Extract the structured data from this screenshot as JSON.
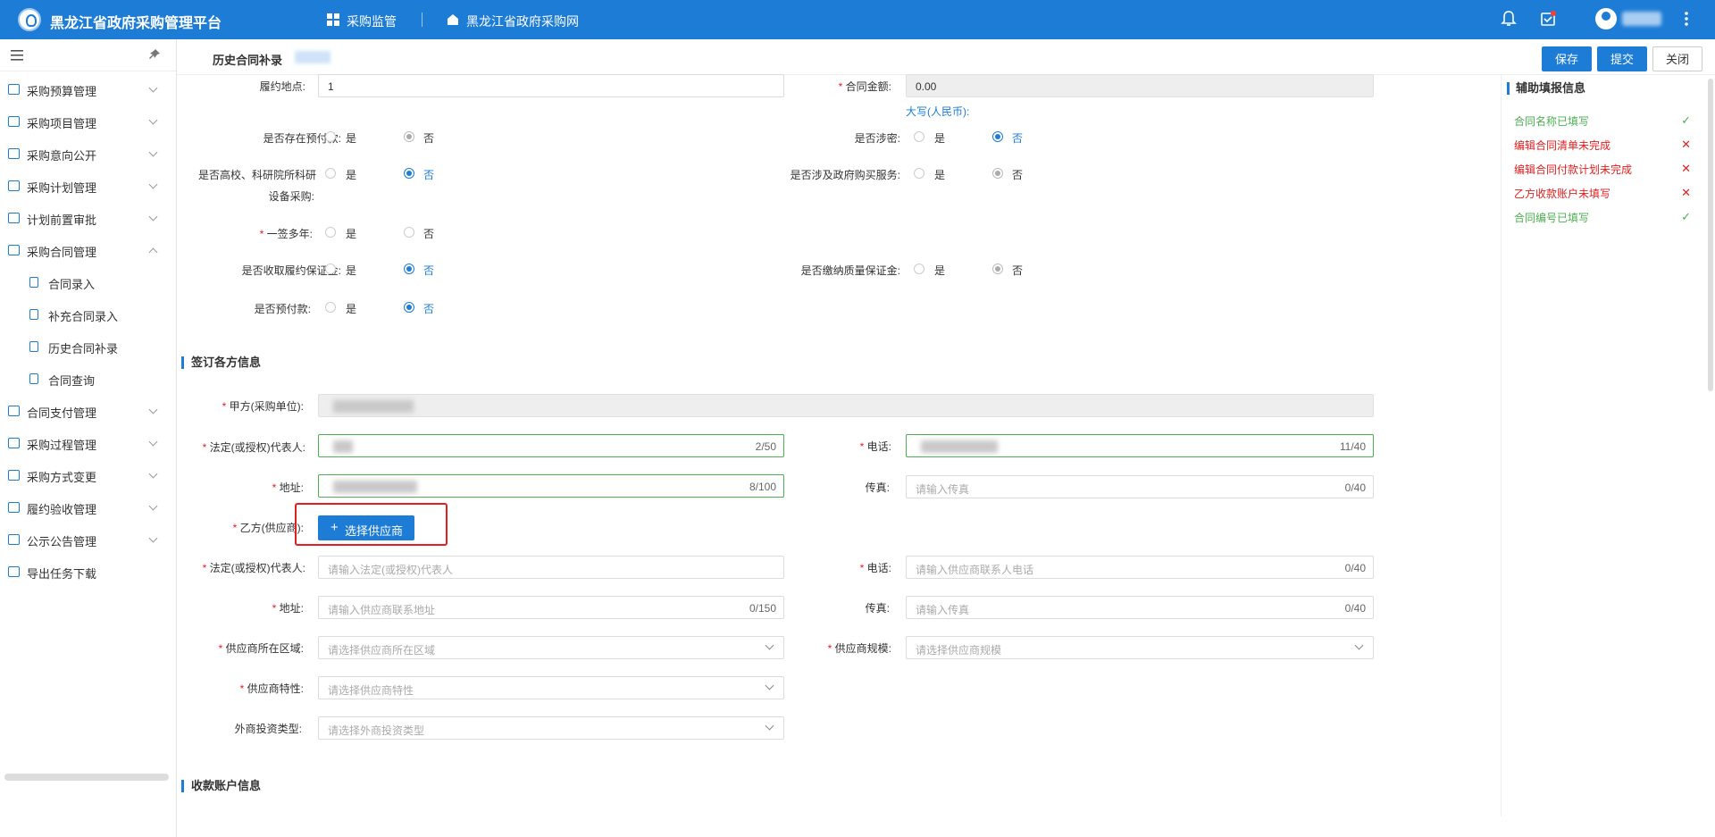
{
  "app": {
    "title": "黑龙江省政府采购管理平台",
    "nav": [
      {
        "label": "采购监管"
      },
      {
        "label": "黑龙江省政府采购网"
      }
    ]
  },
  "sidebar": {
    "items": [
      {
        "label": "采购预算管理"
      },
      {
        "label": "采购项目管理"
      },
      {
        "label": "采购意向公开"
      },
      {
        "label": "采购计划管理"
      },
      {
        "label": "计划前置审批"
      },
      {
        "label": "采购合同管理"
      },
      {
        "label": "合同录入"
      },
      {
        "label": "补充合同录入"
      },
      {
        "label": "历史合同补录"
      },
      {
        "label": "合同查询"
      },
      {
        "label": "合同支付管理"
      },
      {
        "label": "采购过程管理"
      },
      {
        "label": "采购方式变更"
      },
      {
        "label": "履约验收管理"
      },
      {
        "label": "公示公告管理"
      },
      {
        "label": "导出任务下载"
      }
    ]
  },
  "header": {
    "title": "历史合同补录",
    "save": "保存",
    "submit": "提交",
    "close": "关闭"
  },
  "form": {
    "place_label": "履约地点:",
    "place_value": "1",
    "amount_label": "合同金额:",
    "amount_value": "0.00",
    "amount_upper": "大写(人民币):",
    "yes": "是",
    "no": "否",
    "prepay_exist_label": "是否存在预付款:",
    "secret_label": "是否涉密:",
    "univ_label_1": "是否高校、科研院所科研",
    "univ_label_2": "设备采购:",
    "gov_service_label": "是否涉及政府购买服务:",
    "multi_year_label": "一签多年:",
    "perf_deposit_label": "是否收取履约保证金:",
    "quality_deposit_label": "是否缴纳质量保证金:",
    "prepay_label": "是否预付款:"
  },
  "party": {
    "section_title": "签订各方信息",
    "a_unit_label": "甲方(采购单位):",
    "a_rep_label": "法定(或授权)代表人:",
    "a_rep_count": "2/50",
    "a_phone_label": "电话:",
    "a_phone_count": "11/40",
    "a_addr_label": "地址:",
    "a_addr_count": "8/100",
    "a_fax_label": "传真:",
    "a_fax_ph": "请输入传真",
    "a_fax_count": "0/40",
    "b_label": "乙方(供应商):",
    "b_select_btn": "选择供应商",
    "b_rep_label": "法定(或授权)代表人:",
    "b_rep_ph": "请输入法定(或授权)代表人",
    "b_phone_label": "电话:",
    "b_phone_ph": "请输入供应商联系人电话",
    "b_phone_count": "0/40",
    "b_addr_label": "地址:",
    "b_addr_ph": "请输入供应商联系地址",
    "b_addr_count": "0/150",
    "b_fax_label": "传真:",
    "b_fax_ph": "请输入传真",
    "b_fax_count": "0/40",
    "region_label": "供应商所在区域:",
    "region_ph": "请选择供应商所在区域",
    "scale_label": "供应商规模:",
    "scale_ph": "请选择供应商规模",
    "trait_label": "供应商特性:",
    "trait_ph": "请选择供应商特性",
    "foreign_label": "外商投资类型:",
    "foreign_ph": "请选择外商投资类型"
  },
  "account": {
    "section_title": "收款账户信息"
  },
  "aux": {
    "title": "辅助填报信息",
    "items": [
      {
        "label": "合同名称已填写",
        "status": "ok"
      },
      {
        "label": "编辑合同清单未完成",
        "status": "bad"
      },
      {
        "label": "编辑合同付款计划未完成",
        "status": "bad"
      },
      {
        "label": "乙方收款账户未填写",
        "status": "bad"
      },
      {
        "label": "合同编号已填写",
        "status": "ok"
      }
    ]
  },
  "icons": {
    "menu": "hamburger-icon",
    "pin": "pin-icon",
    "bell": "bell-icon",
    "task": "task-check-icon",
    "more": "more-vertical-icon"
  },
  "colors": {
    "brand": "#1d7cd6",
    "required": "#e02020",
    "ok": "#4caf50"
  }
}
